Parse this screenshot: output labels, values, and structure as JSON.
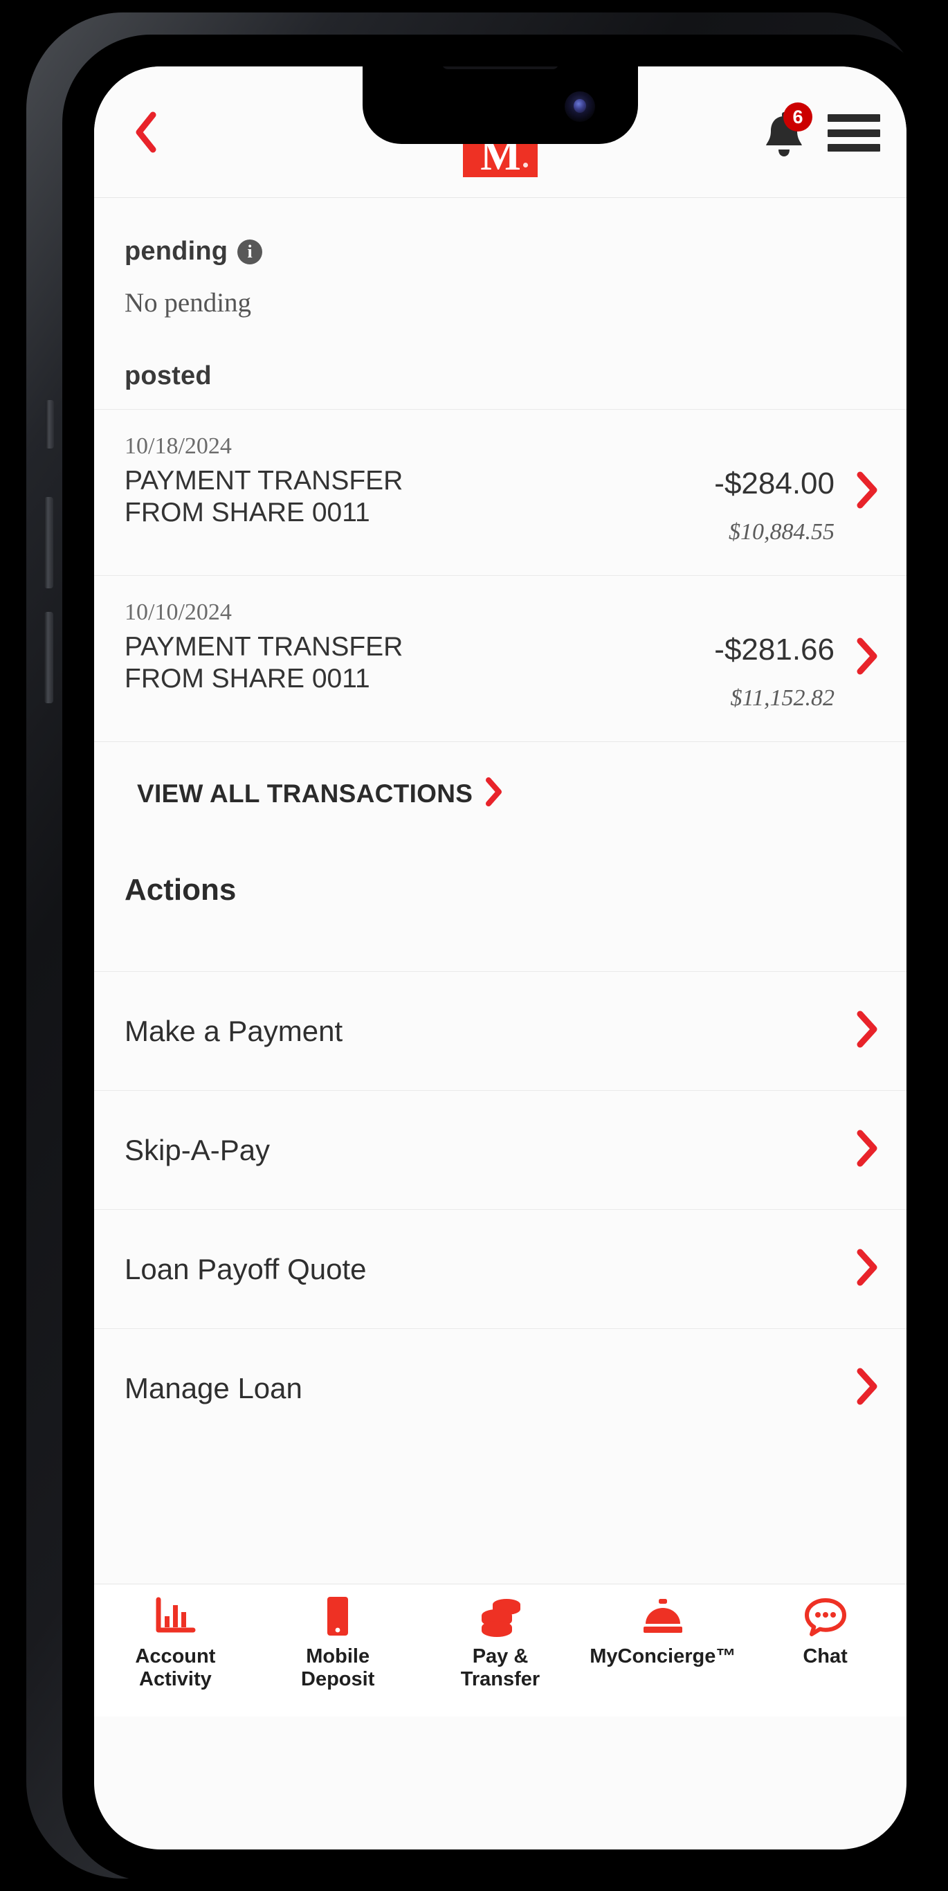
{
  "colors": {
    "brand_red": "#ee3124",
    "chevron_red": "#e8232a",
    "badge_red": "#cc0000",
    "screen_bg": "#fbfbfb",
    "text_dark": "#2f2f2f"
  },
  "header": {
    "back_icon": "chevron-left-icon",
    "logo_letter": "M",
    "logo_mark": "registered-dot",
    "bell_icon": "notification-bell-icon",
    "notification_count": "6",
    "menu_icon": "hamburger-menu-icon"
  },
  "pending": {
    "title": "pending",
    "info_icon": "info-icon",
    "info_glyph": "i",
    "empty_text": "No pending"
  },
  "posted": {
    "title": "posted",
    "transactions": [
      {
        "date": "10/18/2024",
        "description": "PAYMENT TRANSFER FROM SHARE 0011",
        "amount": "-$284.00",
        "balance": "$10,884.55"
      },
      {
        "date": "10/10/2024",
        "description": "PAYMENT TRANSFER FROM SHARE 0011",
        "amount": "-$281.66",
        "balance": "$11,152.82"
      }
    ],
    "view_all_label": "VIEW ALL TRANSACTIONS"
  },
  "actions": {
    "heading": "Actions",
    "items": [
      {
        "label": "Make a Payment"
      },
      {
        "label": "Skip-A-Pay"
      },
      {
        "label": "Loan Payoff Quote"
      },
      {
        "label": "Manage Loan"
      }
    ]
  },
  "bottom_nav": {
    "items": [
      {
        "label": "Account\nActivity",
        "icon": "bar-chart-icon"
      },
      {
        "label": "Mobile\nDeposit",
        "icon": "mobile-phone-icon"
      },
      {
        "label": "Pay &\nTransfer",
        "icon": "coins-stack-icon"
      },
      {
        "label": "MyConcierge™",
        "icon": "service-bell-icon"
      },
      {
        "label": "Chat",
        "icon": "chat-bubble-icon"
      }
    ]
  }
}
